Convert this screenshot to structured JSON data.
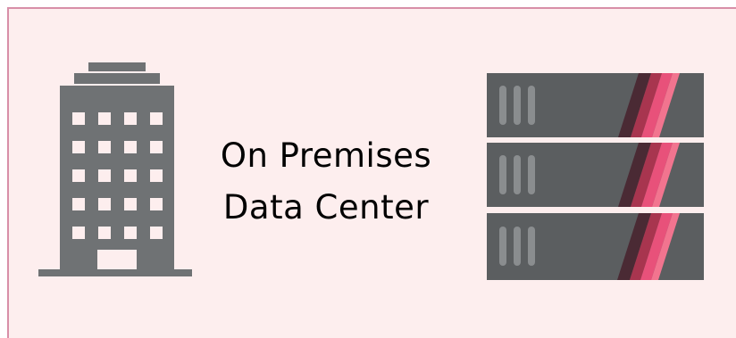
{
  "label": {
    "line1": "On Premises",
    "line2": "Data Center"
  },
  "icons": {
    "building": "office-building-icon",
    "servers": "server-rack-icon"
  },
  "colors": {
    "background": "#fdeeee",
    "border": "#d88fa8",
    "icon_gray": "#6f7274",
    "server_body": "#5b5e60",
    "server_slot": "#8a8d8f",
    "stripe_dark": "#4a2a34",
    "stripe_mid": "#a8354f",
    "stripe_bright": "#e8517a",
    "stripe_light": "#f2748f"
  }
}
